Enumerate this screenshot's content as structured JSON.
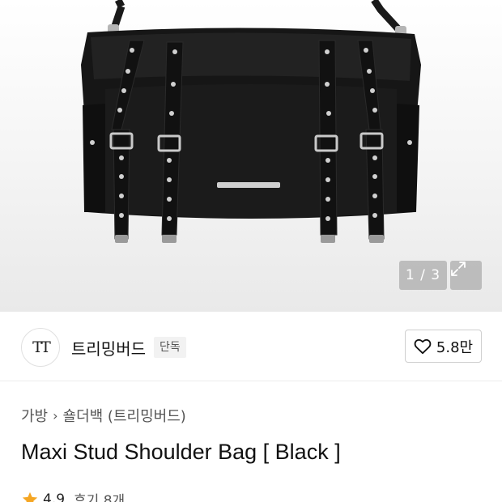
{
  "gallery": {
    "counter": "1 / 3",
    "image_alt": "Maxi Stud Shoulder Bag [ Black ]"
  },
  "brand": {
    "logo_text": "TT",
    "name": "트리밍버드",
    "badge": "단독"
  },
  "like": {
    "count": "5.8만"
  },
  "breadcrumb": {
    "category": "가방",
    "subcategory": "숄더백 (트리밍버드)"
  },
  "product": {
    "title": "Maxi Stud Shoulder Bag [ Black ]"
  },
  "rating": {
    "score": "4.9",
    "reviews": "후기 8개"
  },
  "colors": {
    "star": "#f5a623",
    "bag": "#141414"
  }
}
